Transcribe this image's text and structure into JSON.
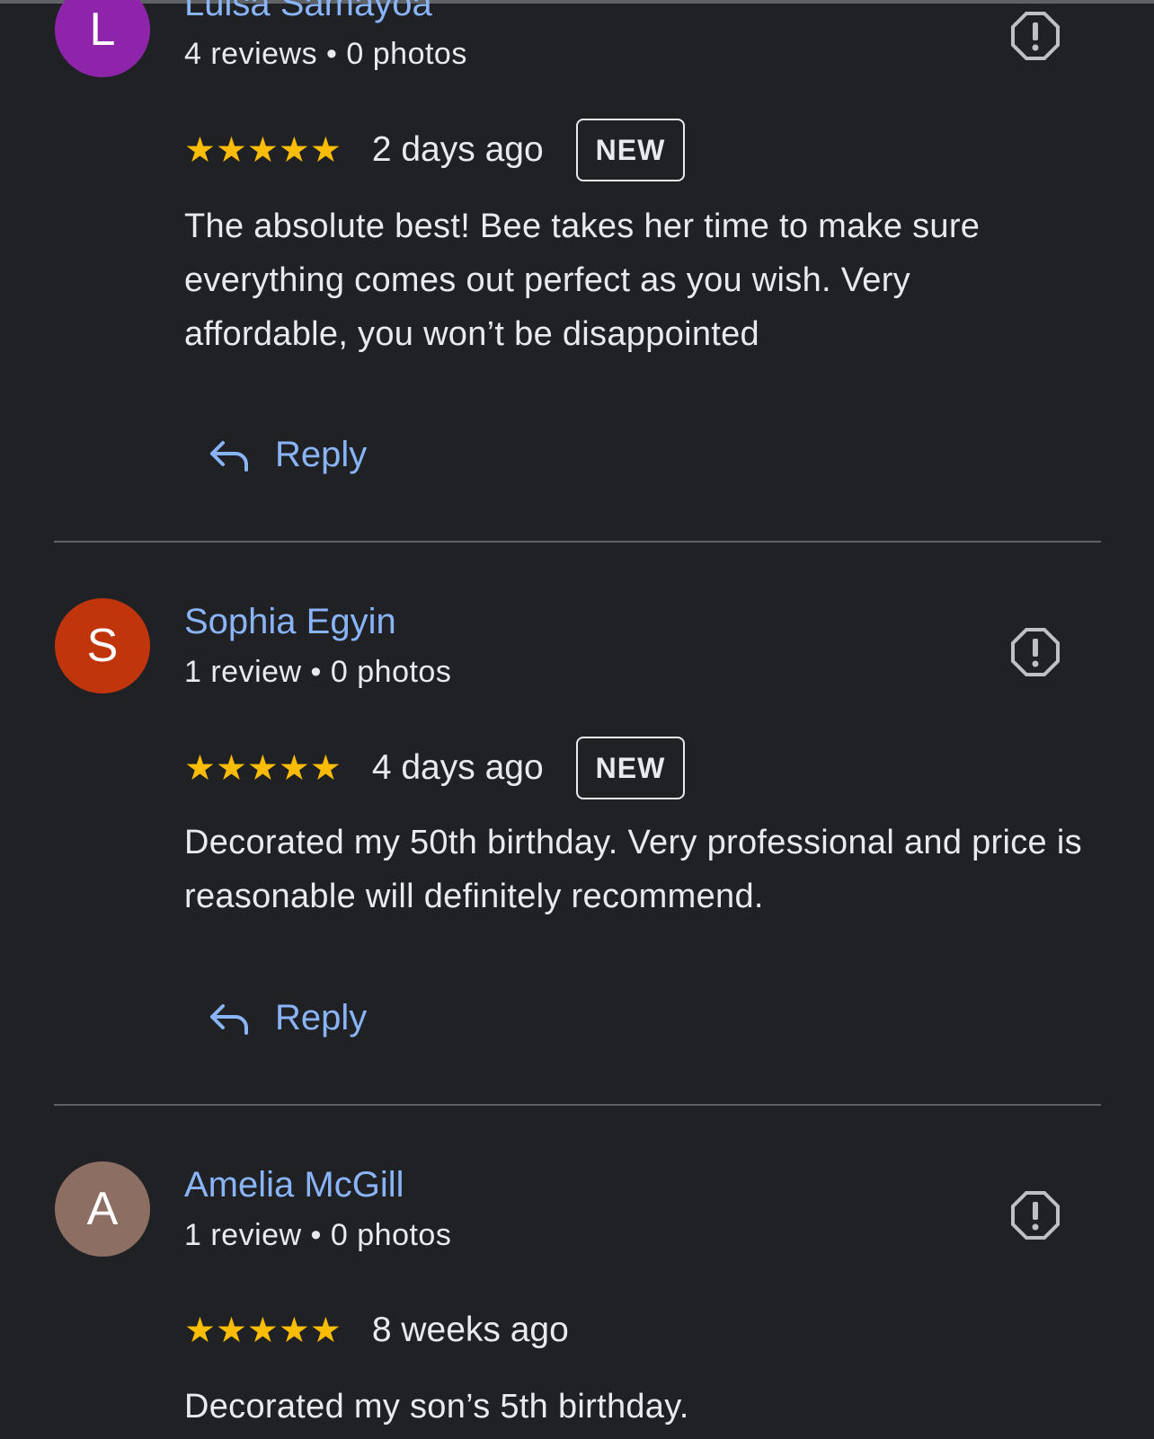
{
  "reviews": [
    {
      "avatar_letter": "L",
      "avatar_color": "#8e24aa",
      "name": "Luisa Samayoa",
      "meta": "4 reviews • 0 photos",
      "stars": "★★★★★",
      "rating": 5,
      "date": "2 days ago",
      "badge": "NEW",
      "text": "The absolute best! Bee takes her time to make sure everything comes out perfect as you wish. Very affordable, you won’t be disappointed",
      "reply_label": "Reply"
    },
    {
      "avatar_letter": "S",
      "avatar_color": "#c1350d",
      "name": "Sophia Egyin",
      "meta": "1 review • 0 photos",
      "stars": "★★★★★",
      "rating": 5,
      "date": "4 days ago",
      "badge": "NEW",
      "text": "Decorated my 50th birthday. Very professional and price is reasonable will definitely recommend.",
      "reply_label": "Reply"
    },
    {
      "avatar_letter": "A",
      "avatar_color": "#8d6e63",
      "name": "Amelia McGill",
      "meta": "1 review • 0 photos",
      "stars": "★★★★★",
      "rating": 5,
      "date": "8 weeks ago",
      "text": "Decorated my son’s 5th birthday."
    }
  ],
  "icons": {
    "flag": "report-flag-icon",
    "reply": "reply-arrow-icon"
  },
  "colors": {
    "background": "#202124",
    "link": "#8ab4f8",
    "star": "#fbbc04",
    "text": "#e8eaed"
  }
}
